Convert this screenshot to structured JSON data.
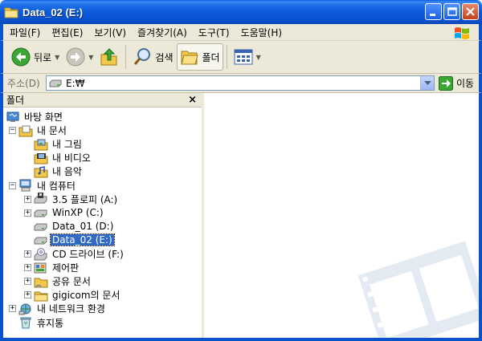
{
  "window": {
    "title": "Data_02 (E:)"
  },
  "menu": [
    "파일(F)",
    "편집(E)",
    "보기(V)",
    "즐겨찾기(A)",
    "도구(T)",
    "도움말(H)"
  ],
  "toolbar": {
    "back": "뒤로",
    "search": "검색",
    "folders": "폴더"
  },
  "address": {
    "label": "주소(D)",
    "value": "E:₩",
    "go": "이동"
  },
  "folder_pane": {
    "title": "폴더",
    "close": "×",
    "items": [
      {
        "label": "바탕 화면",
        "level": 0,
        "expander": "",
        "icon": "desktop-icon"
      },
      {
        "label": "내 문서",
        "level": 1,
        "expander": "−",
        "icon": "my-documents-icon"
      },
      {
        "label": "내 그림",
        "level": 2,
        "expander": "",
        "icon": "pictures-folder-icon"
      },
      {
        "label": "내 비디오",
        "level": 2,
        "expander": "",
        "icon": "video-folder-icon"
      },
      {
        "label": "내 음악",
        "level": 2,
        "expander": "",
        "icon": "music-folder-icon"
      },
      {
        "label": "내 컴퓨터",
        "level": 1,
        "expander": "−",
        "icon": "my-computer-icon"
      },
      {
        "label": "3.5 플로피 (A:)",
        "level": 2,
        "expander": "+",
        "icon": "floppy-drive-icon"
      },
      {
        "label": "WinXP (C:)",
        "level": 2,
        "expander": "+",
        "icon": "hard-drive-icon"
      },
      {
        "label": "Data_01 (D:)",
        "level": 2,
        "expander": "",
        "icon": "hard-drive-icon"
      },
      {
        "label": "Data_02 (E:)",
        "level": 2,
        "expander": "",
        "icon": "hard-drive-icon",
        "selected": true
      },
      {
        "label": "CD 드라이브 (F:)",
        "level": 2,
        "expander": "+",
        "icon": "cd-drive-icon"
      },
      {
        "label": "제어판",
        "level": 2,
        "expander": "+",
        "icon": "control-panel-icon"
      },
      {
        "label": "공유 문서",
        "level": 2,
        "expander": "+",
        "icon": "shared-folder-icon"
      },
      {
        "label": "gigicom의 문서",
        "level": 2,
        "expander": "+",
        "icon": "folder-icon"
      },
      {
        "label": "내 네트워크 환경",
        "level": 1,
        "expander": "+",
        "icon": "network-icon"
      },
      {
        "label": "휴지통",
        "level": 1,
        "expander": "",
        "icon": "recycle-bin-icon"
      }
    ]
  }
}
